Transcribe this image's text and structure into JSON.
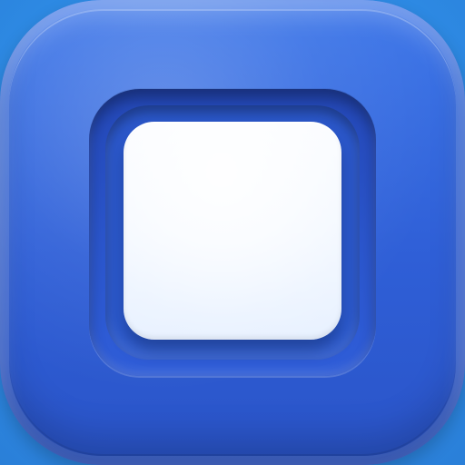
{
  "icon": {
    "name": "stop-square-icon",
    "colors": {
      "background": "#2f8fe9",
      "icon_blue": "#2f5fd7",
      "square_fill": "#e4efff"
    }
  }
}
